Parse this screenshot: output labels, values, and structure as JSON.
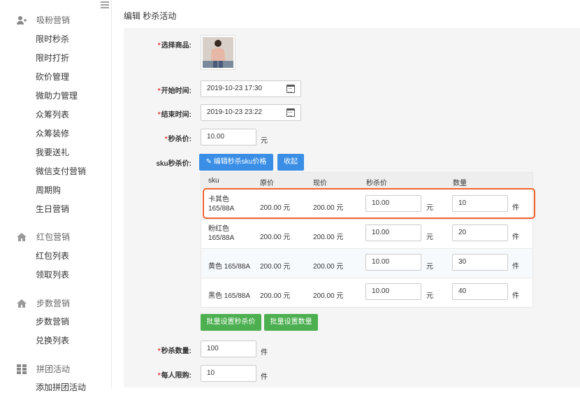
{
  "sidebar": {
    "groups": [
      {
        "label": "吸粉营销",
        "icon": "user-plus-icon",
        "items": [
          "限时秒杀",
          "限时打折",
          "砍价管理",
          "微助力管理",
          "众筹列表",
          "众筹装修",
          "我要送礼",
          "微信支付营销",
          "周期购",
          "生日营销"
        ]
      },
      {
        "label": "红包营销",
        "icon": "home-icon",
        "items": [
          "红包列表",
          "领取列表"
        ]
      },
      {
        "label": "步数营销",
        "icon": "home-icon",
        "items": [
          "步数营销",
          "兑换列表"
        ]
      },
      {
        "label": "拼团活动",
        "icon": "grid-icon",
        "items": [
          "添加拼团活动"
        ]
      }
    ]
  },
  "page": {
    "title": "编辑 秒杀活动"
  },
  "form": {
    "product_label": "选择商品:",
    "start_label": "开始时间:",
    "start_value": "2019-10-23 17:30",
    "end_label": "结束时间:",
    "end_value": "2019-10-23 23:22",
    "price_label": "秒杀价:",
    "price_value": "10.00",
    "price_unit": "元",
    "sku_label": "sku秒杀价:",
    "edit_sku_btn": "编辑秒杀sku价格",
    "collapse_btn": "收起",
    "batch_price_btn": "批量设置秒杀价",
    "batch_qty_btn": "批量设置数量",
    "qty_label": "秒杀数量:",
    "qty_value": "100",
    "qty_unit": "件",
    "limit_label": "每人限购:",
    "limit_value": "10",
    "limit_unit": "件"
  },
  "sku_table": {
    "headers": [
      "sku",
      "原价",
      "现价",
      "秒杀价",
      "数量"
    ],
    "rows": [
      {
        "sku": "卡其色 165/88A",
        "orig": "200.00 元",
        "now": "200.00 元",
        "price": "10.00",
        "price_unit": "元",
        "qty": "10",
        "qty_unit": "件"
      },
      {
        "sku": "粉红色 165/88A",
        "orig": "200.00 元",
        "now": "200.00 元",
        "price": "10.00",
        "price_unit": "元",
        "qty": "20",
        "qty_unit": "件"
      },
      {
        "sku": "黄色 165/88A",
        "orig": "200.00 元",
        "now": "200.00 元",
        "price": "10.00",
        "price_unit": "元",
        "qty": "30",
        "qty_unit": "件"
      },
      {
        "sku": "黑色 165/88A",
        "orig": "200.00 元",
        "now": "200.00 元",
        "price": "10.00",
        "price_unit": "元",
        "qty": "40",
        "qty_unit": "件"
      }
    ]
  },
  "colors": {
    "accent": "#3a8ee6",
    "success": "#4caf50",
    "required": "#e4393c",
    "highlight": "#f0622d"
  }
}
